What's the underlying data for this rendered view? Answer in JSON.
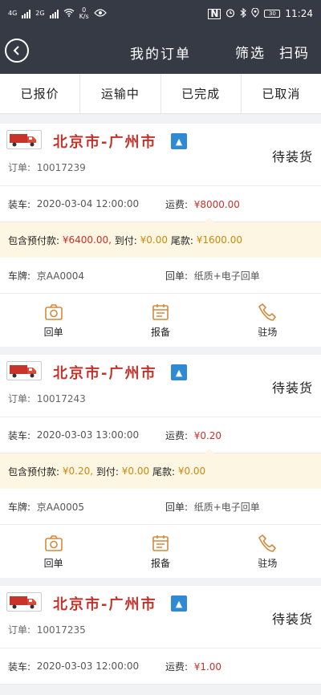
{
  "statusbar": {
    "net_left": "4G",
    "net_right": "2G",
    "speed_value": "0",
    "speed_unit": "K/s",
    "nfc": "N",
    "battery": "30",
    "time": "11:24"
  },
  "header": {
    "title": "我的订单",
    "filter_label": "筛选",
    "scan_label": "扫码"
  },
  "tabs": [
    {
      "label": "已报价"
    },
    {
      "label": "运输中"
    },
    {
      "label": "已完成"
    },
    {
      "label": "已取消"
    }
  ],
  "labels": {
    "order_no": "订单:",
    "loading": "装车:",
    "freight": "运费:",
    "prepay": "包含预付款:",
    "on_arrival": "到付:",
    "balance": "尾款:",
    "plate": "车牌:",
    "receipt": "回单:"
  },
  "actions": {
    "receipt": "回单",
    "report": "报备",
    "on_site": "驻场"
  },
  "orders": [
    {
      "route": "北京市-广州市",
      "status": "待装货",
      "order_no": "10017239",
      "loading_time": "2020-03-04 12:00:00",
      "freight": "¥8000.00",
      "prepay": "¥6400.00,",
      "on_arrival": "¥0.00",
      "balance": "¥1600.00",
      "plate": "京AA0004",
      "receipt_type": "纸质+电子回单"
    },
    {
      "route": "北京市-广州市",
      "status": "待装货",
      "order_no": "10017243",
      "loading_time": "2020-03-03 13:00:00",
      "freight": "¥0.20",
      "prepay": "¥0.20,",
      "on_arrival": "¥0.00",
      "balance": "¥0.00",
      "plate": "京AA0005",
      "receipt_type": "纸质+电子回单"
    },
    {
      "route": "北京市-广州市",
      "status": "待装货",
      "order_no": "10017235",
      "loading_time": "2020-03-03 12:00:00",
      "freight": "¥1.00"
    }
  ],
  "colors": {
    "header_bg": "#353a45",
    "route_red": "#c4332b",
    "amount_orange": "#c88a10",
    "prepay_bg": "#fdf6e2",
    "arrow_blue": "#2f8ad6"
  }
}
